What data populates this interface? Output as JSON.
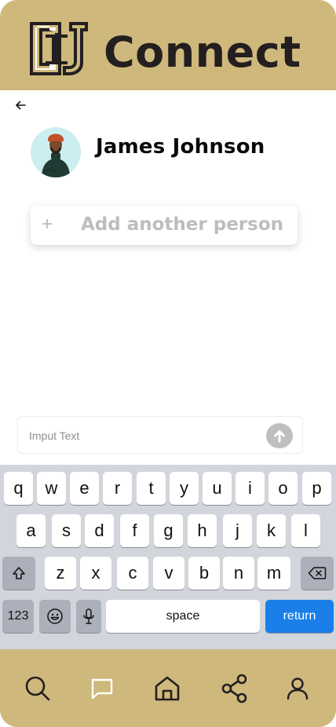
{
  "header": {
    "title": "Connect",
    "logo_icon": "cu-logo-icon"
  },
  "back": {
    "icon": "arrow-left-icon"
  },
  "person": {
    "name": "James Johnson",
    "avatar": "person-avatar"
  },
  "add_person": {
    "plus": "+",
    "label": "Add another person"
  },
  "composer": {
    "placeholder": "Imput Text",
    "value": "",
    "send_icon": "arrow-up-icon"
  },
  "keyboard": {
    "row1": [
      "q",
      "w",
      "e",
      "r",
      "t",
      "y",
      "u",
      "i",
      "o",
      "p"
    ],
    "row2": [
      "a",
      "s",
      "d",
      "f",
      "g",
      "h",
      "j",
      "k",
      "l"
    ],
    "row3": [
      "z",
      "x",
      "c",
      "v",
      "b",
      "n",
      "m"
    ],
    "numbers_label": "123",
    "space_label": "space",
    "return_label": "return",
    "shift_icon": "shift-icon",
    "delete_icon": "backspace-icon",
    "emoji_icon": "emoji-icon",
    "mic_icon": "microphone-icon"
  },
  "nav": {
    "items": [
      {
        "id": "search",
        "icon": "search-icon"
      },
      {
        "id": "messages",
        "icon": "chat-bubble-icon",
        "active": true
      },
      {
        "id": "home",
        "icon": "home-icon"
      },
      {
        "id": "share",
        "icon": "share-icon"
      },
      {
        "id": "profile",
        "icon": "user-icon"
      }
    ]
  },
  "colors": {
    "gold": "#CFB87C",
    "return_blue": "#1a7fe8",
    "keyboard_bg": "#d2d5db",
    "active_nav": "#ffffff"
  }
}
